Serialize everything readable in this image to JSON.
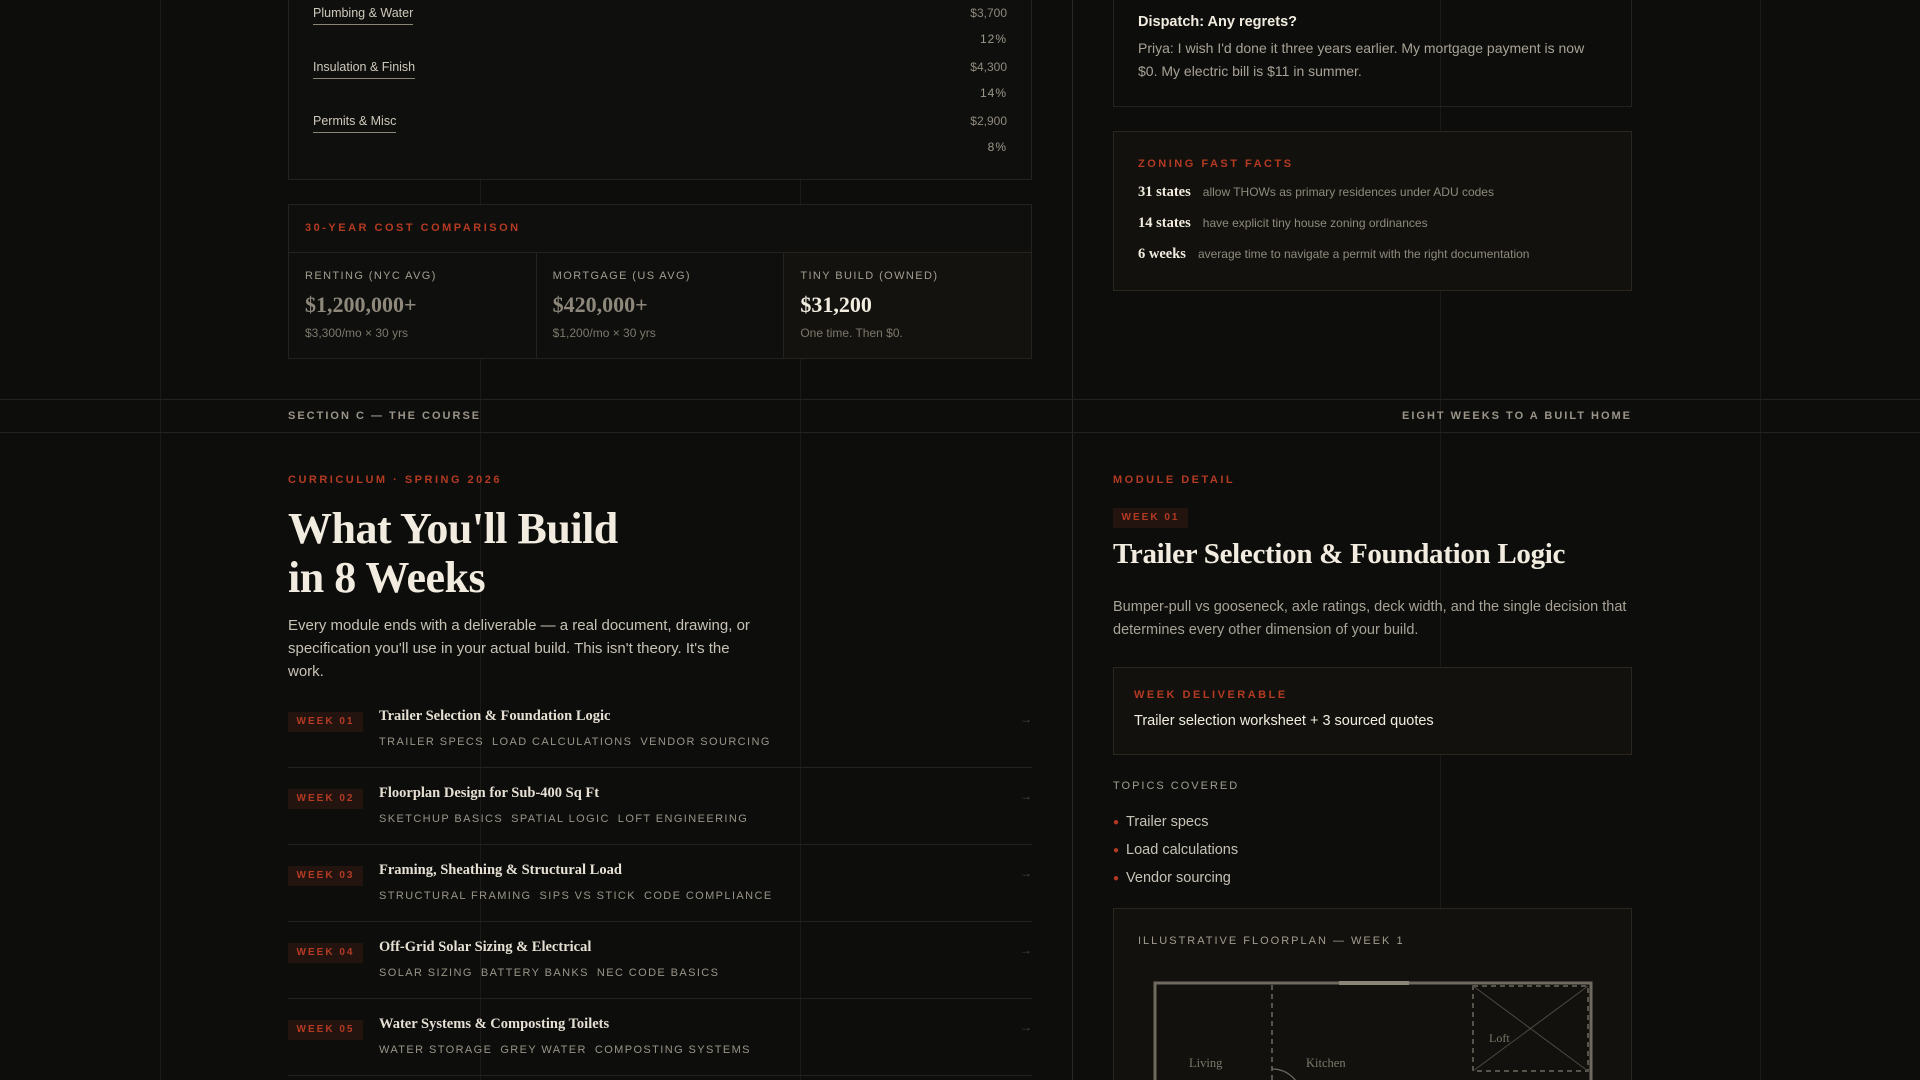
{
  "breakdown": {
    "rows": [
      {
        "label": "Plumbing & Water",
        "amount": "$3,700",
        "pct": "12%"
      },
      {
        "label": "Insulation & Finish",
        "amount": "$4,300",
        "pct": "14%"
      },
      {
        "label": "Permits & Misc",
        "amount": "$2,900",
        "pct": "8%"
      }
    ]
  },
  "comparison": {
    "heading": "30-YEAR COST COMPARISON",
    "columns": [
      {
        "label": "RENTING (NYC AVG)",
        "value": "$1,200,000+",
        "note": "$3,300/mo × 30 yrs"
      },
      {
        "label": "MORTGAGE (US AVG)",
        "value": "$420,000+",
        "note": "$1,200/mo × 30 yrs"
      },
      {
        "label": "TINY BUILD (OWNED)",
        "value": "$31,200",
        "note": "One time. Then $0."
      }
    ]
  },
  "dispatch": {
    "question": "Dispatch: Any regrets?",
    "answer": "Priya: I wish I'd done it three years earlier. My mortgage payment is now $0. My electric bill is $11 in summer."
  },
  "zoning": {
    "heading": "ZONING FAST FACTS",
    "facts": [
      {
        "number": "31 states",
        "text": "allow THOWs as primary residences under ADU codes"
      },
      {
        "number": "14 states",
        "text": "have explicit tiny house zoning ordinances"
      },
      {
        "number": "6 weeks",
        "text": "average time to navigate a permit with the right documentation"
      }
    ]
  },
  "section_bar": {
    "left": "SECTION C — THE COURSE",
    "right": "EIGHT WEEKS TO A BUILT HOME"
  },
  "curriculum": {
    "eyebrow": "CURRICULUM · SPRING 2026",
    "title_line1": "What You'll Build",
    "title_line2": "in 8 Weeks",
    "description": "Every module ends with a deliverable — a real document, drawing, or specification you'll use in your actual build. This isn't theory. It's the work.",
    "arrow": "→",
    "weeks": [
      {
        "badge": "WEEK 01",
        "title": "Trailer Selection & Foundation Logic",
        "tags": [
          "TRAILER SPECS",
          "LOAD CALCULATIONS",
          "VENDOR SOURCING"
        ]
      },
      {
        "badge": "WEEK 02",
        "title": "Floorplan Design for Sub-400 Sq Ft",
        "tags": [
          "SKETCHUP BASICS",
          "SPATIAL LOGIC",
          "LOFT ENGINEERING"
        ]
      },
      {
        "badge": "WEEK 03",
        "title": "Framing, Sheathing & Structural Load",
        "tags": [
          "STRUCTURAL FRAMING",
          "SIPS VS STICK",
          "CODE COMPLIANCE"
        ]
      },
      {
        "badge": "WEEK 04",
        "title": "Off-Grid Solar Sizing & Electrical",
        "tags": [
          "SOLAR SIZING",
          "BATTERY BANKS",
          "NEC CODE BASICS"
        ]
      },
      {
        "badge": "WEEK 05",
        "title": "Water Systems & Composting Toilets",
        "tags": [
          "WATER STORAGE",
          "GREY WATER",
          "COMPOSTING SYSTEMS"
        ]
      }
    ]
  },
  "module": {
    "eyebrow": "MODULE DETAIL",
    "badge": "WEEK 01",
    "title": "Trailer Selection & Foundation Logic",
    "description": "Bumper-pull vs gooseneck, axle ratings, deck width, and the single decision that determines every other dimension of your build.",
    "deliverable_heading": "WEEK DELIVERABLE",
    "deliverable_text": "Trailer selection worksheet + 3 sourced quotes",
    "topics_heading": "TOPICS COVERED",
    "topics": [
      "Trailer specs",
      "Load calculations",
      "Vendor sourcing"
    ],
    "floorplan_heading": "ILLUSTRATIVE FLOORPLAN — WEEK 1",
    "floorplan_labels": {
      "living": "Living",
      "kitchen": "Kitchen",
      "loft": "Loft"
    }
  },
  "colors": {
    "accent": "#b43a22",
    "background": "#0d0d0c",
    "text": "#f1ecdf"
  }
}
